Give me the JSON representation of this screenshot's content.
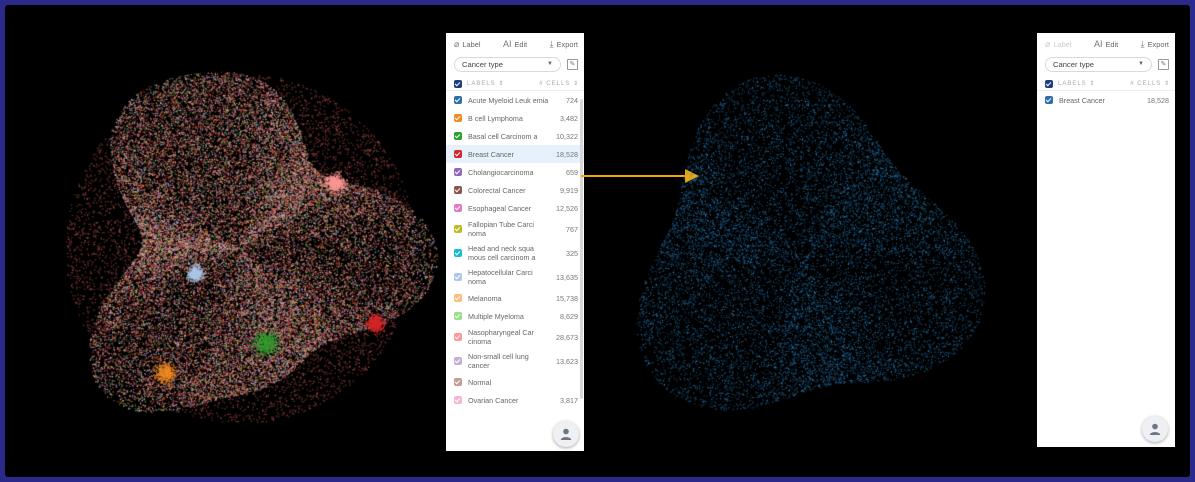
{
  "left_panel": {
    "toolbar": {
      "label": "Label",
      "edit": "Edit",
      "export": "Export"
    },
    "select": {
      "value": "Cancer type"
    },
    "header": {
      "labels": "LABELS",
      "labels_sort": "⇕",
      "cells": "# CELLS",
      "cells_sort": "⇕"
    },
    "header_color": "#1f3f7a",
    "rows": [
      {
        "name": "Acute Myeloid Leuk emia",
        "count": "724",
        "color": "#2f6fa8"
      },
      {
        "name": "B cell Lymphoma",
        "count": "3,482",
        "color": "#f08a24"
      },
      {
        "name": "Basal cell Carcinom a",
        "count": "10,322",
        "color": "#2ca02c"
      },
      {
        "name": "Breast Cancer",
        "count": "18,528",
        "color": "#d62728",
        "selected": true
      },
      {
        "name": "Cholangiocarcinoma",
        "count": "659",
        "color": "#9467bd"
      },
      {
        "name": "Colorectal Cancer",
        "count": "9,919",
        "color": "#8c564b"
      },
      {
        "name": "Esophageal Cancer",
        "count": "12,526",
        "color": "#e377c2"
      },
      {
        "name": "Fallopian Tube Carci noma",
        "count": "767",
        "color": "#bcbd22"
      },
      {
        "name": "Head and neck squa mous cell carcinom a",
        "count": "325",
        "color": "#17becf"
      },
      {
        "name": "Hepatocellular Carci noma",
        "count": "13,635",
        "color": "#aec7e8"
      },
      {
        "name": "Melanoma",
        "count": "15,738",
        "color": "#ffbb78"
      },
      {
        "name": "Multiple Myeloma",
        "count": "8,629",
        "color": "#98df8a"
      },
      {
        "name": "Nasopharyngeal Car cinoma",
        "count": "28,673",
        "color": "#ff9896"
      },
      {
        "name": "Non-small cell lung cancer",
        "count": "13,623",
        "color": "#c5b0d5"
      },
      {
        "name": "Normal",
        "count": "",
        "color": "#c49c94"
      },
      {
        "name": "Ovarian Cancer",
        "count": "3,817",
        "color": "#f7b6d2"
      }
    ]
  },
  "right_panel": {
    "toolbar": {
      "label": "Label",
      "edit": "Edit",
      "export": "Export"
    },
    "select": {
      "value": "Cancer type"
    },
    "header": {
      "labels": "LABELS",
      "labels_sort": "⇕",
      "cells": "# CELLS",
      "cells_sort": "⇕"
    },
    "header_color": "#1f3f7a",
    "rows": [
      {
        "name": "Breast Cancer",
        "count": "18,528",
        "color": "#2f6fa8"
      }
    ]
  },
  "colors": {
    "background": "#2b2a8a",
    "arrow": "#f5a800",
    "highlight_points": "#2f8fd6"
  }
}
